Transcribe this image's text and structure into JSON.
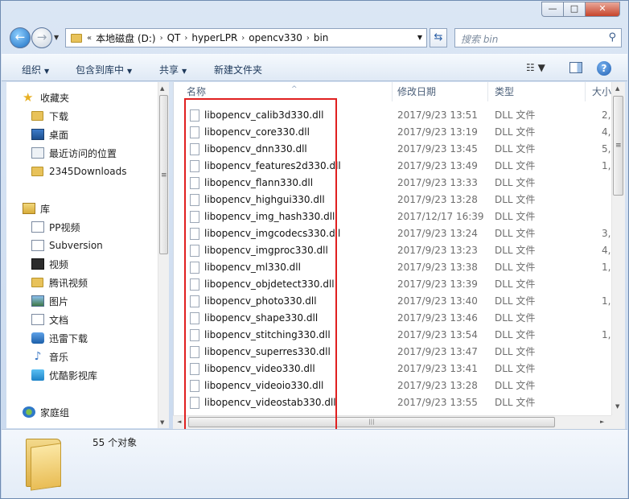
{
  "window": {
    "controls": {
      "minimize": "—",
      "maximize": "□",
      "close": "✕"
    }
  },
  "nav": {
    "back_icon": "arrow-left-icon",
    "forward_icon": "arrow-right-icon",
    "back_glyph": "←",
    "forward_glyph": "→",
    "dropdown_glyph": "▼"
  },
  "address": {
    "overflow": "«",
    "crumbs": [
      "本地磁盘 (D:)",
      "QT",
      "hyperLPR",
      "opencv330",
      "bin"
    ],
    "separator": "›",
    "dropdown_glyph": "▼",
    "refresh_glyph": "⇆"
  },
  "search": {
    "placeholder": "搜索 bin",
    "icon_glyph": "⚲"
  },
  "toolbar": {
    "organize": "组织",
    "include_in_library": "包含到库中",
    "share": "共享",
    "new_folder": "新建文件夹",
    "dropdown_glyph": "▼",
    "view_glyph": "☷ ▼",
    "help_glyph": "?"
  },
  "sidebar": {
    "favorites": {
      "label": "收藏夹",
      "items": [
        "下载",
        "桌面",
        "最近访问的位置",
        "2345Downloads"
      ]
    },
    "libraries": {
      "label": "库",
      "items": [
        "PP视频",
        "Subversion",
        "视频",
        "腾讯视频",
        "图片",
        "文档",
        "迅雷下载",
        "音乐",
        "优酷影视库"
      ]
    },
    "homegroup": {
      "label": "家庭组"
    }
  },
  "columns": {
    "name": "名称",
    "modified": "修改日期",
    "type": "类型",
    "size": "大小",
    "sort_glyph": "^"
  },
  "files": [
    {
      "name": "libopencv_calib3d330.dll",
      "modified": "2017/9/23 13:51",
      "type": "DLL 文件",
      "size": "2,"
    },
    {
      "name": "libopencv_core330.dll",
      "modified": "2017/9/23 13:19",
      "type": "DLL 文件",
      "size": "4,"
    },
    {
      "name": "libopencv_dnn330.dll",
      "modified": "2017/9/23 13:45",
      "type": "DLL 文件",
      "size": "5,"
    },
    {
      "name": "libopencv_features2d330.dll",
      "modified": "2017/9/23 13:49",
      "type": "DLL 文件",
      "size": "1,"
    },
    {
      "name": "libopencv_flann330.dll",
      "modified": "2017/9/23 13:33",
      "type": "DLL 文件",
      "size": ""
    },
    {
      "name": "libopencv_highgui330.dll",
      "modified": "2017/9/23 13:28",
      "type": "DLL 文件",
      "size": ""
    },
    {
      "name": "libopencv_img_hash330.dll",
      "modified": "2017/12/17 16:39",
      "type": "DLL 文件",
      "size": ""
    },
    {
      "name": "libopencv_imgcodecs330.dll",
      "modified": "2017/9/23 13:24",
      "type": "DLL 文件",
      "size": "3,"
    },
    {
      "name": "libopencv_imgproc330.dll",
      "modified": "2017/9/23 13:23",
      "type": "DLL 文件",
      "size": "4,"
    },
    {
      "name": "libopencv_ml330.dll",
      "modified": "2017/9/23 13:38",
      "type": "DLL 文件",
      "size": "1,"
    },
    {
      "name": "libopencv_objdetect330.dll",
      "modified": "2017/9/23 13:39",
      "type": "DLL 文件",
      "size": ""
    },
    {
      "name": "libopencv_photo330.dll",
      "modified": "2017/9/23 13:40",
      "type": "DLL 文件",
      "size": "1,"
    },
    {
      "name": "libopencv_shape330.dll",
      "modified": "2017/9/23 13:46",
      "type": "DLL 文件",
      "size": ""
    },
    {
      "name": "libopencv_stitching330.dll",
      "modified": "2017/9/23 13:54",
      "type": "DLL 文件",
      "size": "1,"
    },
    {
      "name": "libopencv_superres330.dll",
      "modified": "2017/9/23 13:47",
      "type": "DLL 文件",
      "size": ""
    },
    {
      "name": "libopencv_video330.dll",
      "modified": "2017/9/23 13:41",
      "type": "DLL 文件",
      "size": ""
    },
    {
      "name": "libopencv_videoio330.dll",
      "modified": "2017/9/23 13:28",
      "type": "DLL 文件",
      "size": ""
    },
    {
      "name": "libopencv_videostab330.dll",
      "modified": "2017/9/23 13:55",
      "type": "DLL 文件",
      "size": ""
    }
  ],
  "scrollbars": {
    "up": "▲",
    "down": "▼",
    "left": "◄",
    "right": "►",
    "grip_v": "≡",
    "grip_h": "|||"
  },
  "status": {
    "object_count": "55 个对象"
  },
  "colors": {
    "highlight": "#e02020",
    "toolbar_text": "#1e395b",
    "accent": "#2a5fa6"
  }
}
